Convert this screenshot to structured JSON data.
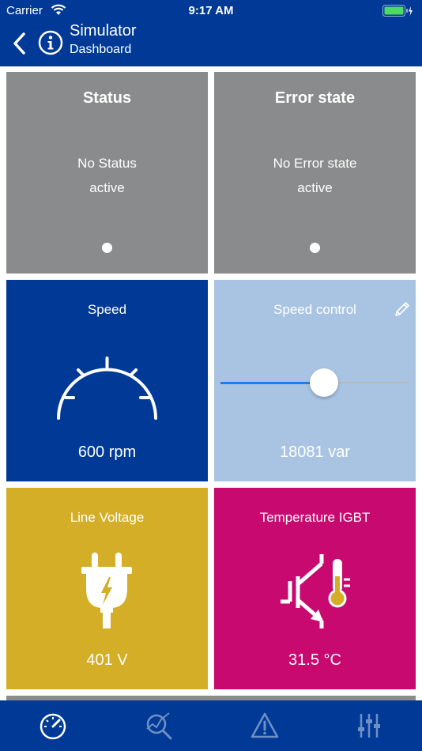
{
  "status_bar": {
    "carrier": "Carrier",
    "time": "9:17 AM",
    "wifi_icon": "wifi-icon",
    "battery_icon": "battery-icon"
  },
  "nav": {
    "title": "Simulator",
    "subtitle": "Dashboard",
    "back_icon": "chevron-left-icon",
    "info_icon": "info-icon"
  },
  "tiles": {
    "status": {
      "title": "Status",
      "message_line1": "No Status",
      "message_line2": "active",
      "color": "#8a8b8c"
    },
    "error": {
      "title": "Error state",
      "message_line1": "No Error state",
      "message_line2": "active",
      "color": "#8a8b8c"
    },
    "speed": {
      "title": "Speed",
      "value": "600 rpm",
      "icon": "gauge-icon",
      "color": "#003a96"
    },
    "speed_control": {
      "title": "Speed control",
      "value": "18081 var",
      "slider_fraction": 0.55,
      "icon": "pencil-icon",
      "color": "#a9c4e3"
    },
    "line_voltage": {
      "title": "Line Voltage",
      "value": "401 V",
      "icon": "plug-icon",
      "color": "#d4ae26"
    },
    "temperature": {
      "title": "Temperature IGBT",
      "value": "31.5 °C",
      "icon": "igbt-temperature-icon",
      "color": "#c8096f"
    }
  },
  "tab_bar": {
    "items": [
      {
        "icon": "dashboard-gauge-icon",
        "selected": true
      },
      {
        "icon": "analyze-magnifier-icon",
        "selected": false
      },
      {
        "icon": "warning-triangle-icon",
        "selected": false
      },
      {
        "icon": "sliders-icon",
        "selected": false
      }
    ]
  },
  "colors": {
    "brand_blue": "#003a96",
    "slider_blue": "#1a7ef5"
  }
}
